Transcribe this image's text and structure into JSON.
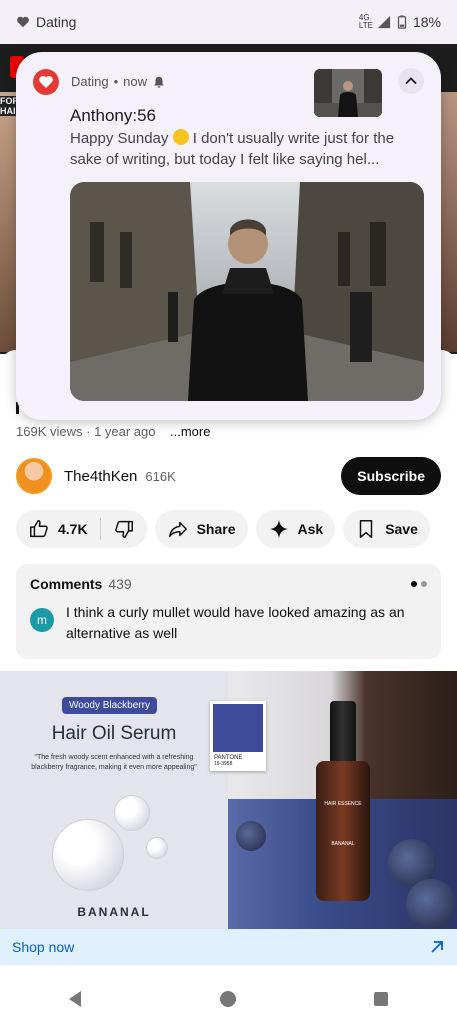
{
  "status_bar": {
    "app_label": "Dating",
    "network": "4G LTE",
    "battery": "18%"
  },
  "video": {
    "left_overlay_text": "FOR HAI"
  },
  "notification": {
    "app_name": "Dating",
    "separator": "•",
    "time": "now",
    "sender": "Anthony:56",
    "message_part1": "Happy Sunday",
    "message_part2": "I don't usually write just for the sake of writing, but today I felt like saying hel..."
  },
  "video_meta": {
    "views": "169K views",
    "age": "1 year ago",
    "more": "...more"
  },
  "channel": {
    "name": "The4thKen",
    "subscribers": "616K",
    "subscribe_label": "Subscribe"
  },
  "actions": {
    "likes": "4.7K",
    "share": "Share",
    "ask": "Ask",
    "save": "Save"
  },
  "comments": {
    "title": "Comments",
    "count": "439",
    "avatar_letter": "m",
    "top_comment": "I think a curly mullet would have looked amazing as an alternative as well"
  },
  "ad": {
    "badge": "Woody Blackberry",
    "title": "Hair Oil Serum",
    "description": "\"The fresh woody scent enhanced with a refreshing blackberry fragrance, making it even more appealing\"",
    "brand": "BANANAL",
    "pantone_label": "PANTONE",
    "pantone_code": "19-3958",
    "bottle_label": "HAIR ESSENCE",
    "bottle_brand": "BANANAL",
    "cta": "Shop now",
    "accent_color": "#3e4b9b"
  },
  "colors": {
    "subscribe_bg": "#0f0f0f",
    "link_blue": "#065fd4",
    "notif_bg": "#f4f1fa",
    "app_icon": "#e53935",
    "comment_avatar": "#1a9aa6"
  },
  "icons": {
    "status_app": "dating-heart-icon",
    "like": "thumb-up-icon",
    "dislike": "thumb-down-icon",
    "share": "share-arrow-icon",
    "ask": "sparkle-icon",
    "save": "bookmark-icon",
    "expand": "chevron-up-icon",
    "bell": "bell-icon",
    "shop": "arrow-up-right-icon"
  }
}
